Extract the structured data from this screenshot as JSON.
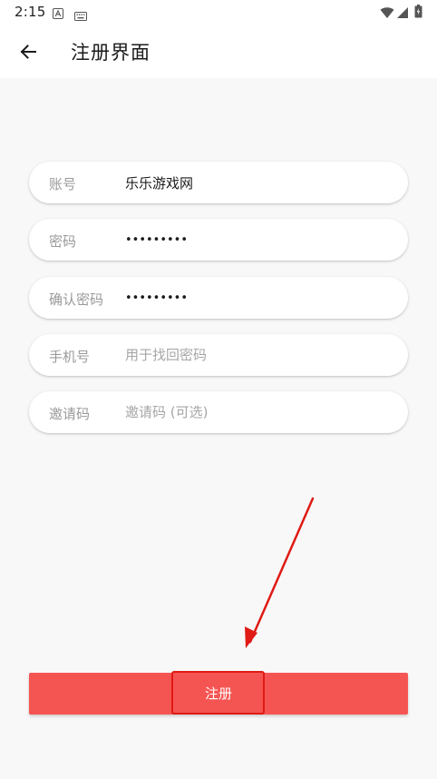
{
  "status_bar": {
    "time": "2:15",
    "icons": [
      "a-notification-icon",
      "keyboard-icon",
      "wifi-icon",
      "signal-icon",
      "battery-icon"
    ]
  },
  "app_bar": {
    "back_icon": "arrow-left-icon",
    "title": "注册界面"
  },
  "form": {
    "account": {
      "label": "账号",
      "value": "乐乐游戏网",
      "placeholder": ""
    },
    "password": {
      "label": "密码",
      "value": "•••••••••",
      "placeholder": ""
    },
    "confirm_password": {
      "label": "确认密码",
      "value": "•••••••••",
      "placeholder": ""
    },
    "phone": {
      "label": "手机号",
      "value": "",
      "placeholder": "用于找回密码"
    },
    "invite_code": {
      "label": "邀请码",
      "value": "",
      "placeholder": "邀请码 (可选)"
    }
  },
  "register_button": {
    "label": "注册"
  },
  "colors": {
    "accent": "#f55552",
    "annotation": "#e01a14",
    "background": "#f8f8f8"
  }
}
